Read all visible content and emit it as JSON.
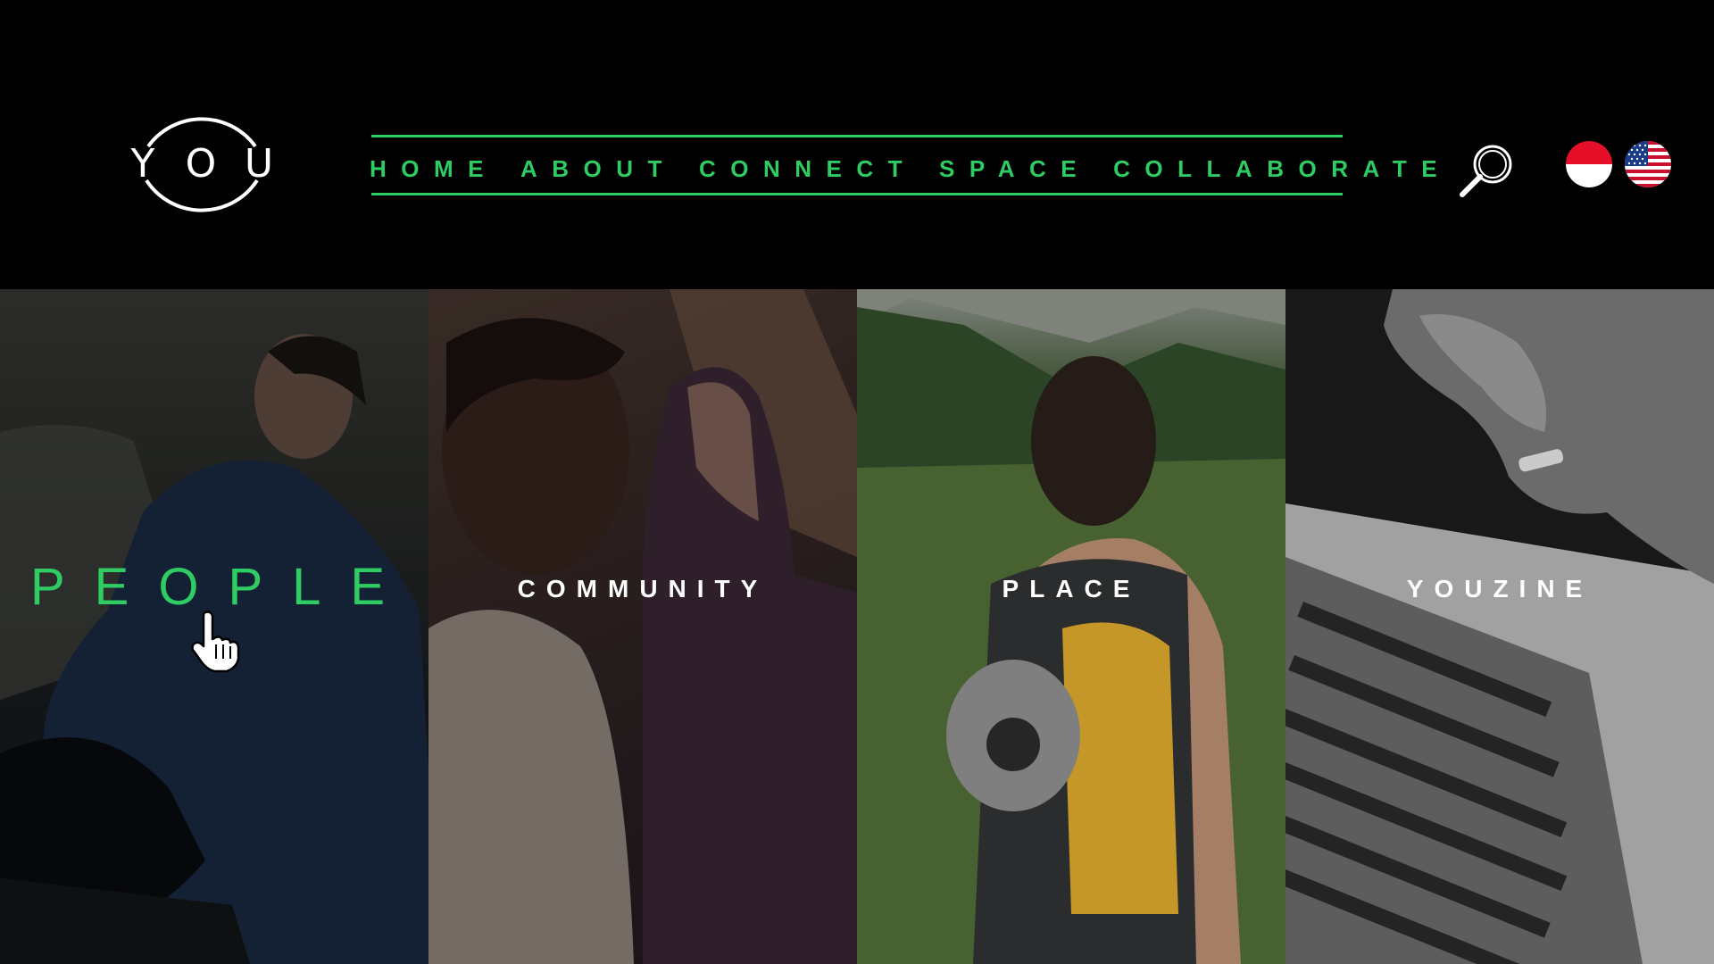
{
  "brand": {
    "logo_letters": [
      "Y",
      "O",
      "U"
    ]
  },
  "nav": {
    "items": [
      {
        "label": "HOME"
      },
      {
        "label": "ABOUT"
      },
      {
        "label": "CONNECT"
      },
      {
        "label": "SPACE"
      },
      {
        "label": "COLLABORATE"
      }
    ],
    "accent_color": "#2ecc62"
  },
  "header_icons": {
    "search": "search-icon",
    "languages": [
      "indonesia-flag-icon",
      "us-flag-icon"
    ]
  },
  "panels": [
    {
      "label": "PEOPLE",
      "active": true
    },
    {
      "label": "COMMUNITY",
      "active": false
    },
    {
      "label": "PLACE",
      "active": false
    },
    {
      "label": "YOUZINE",
      "active": false
    }
  ],
  "cursor": "pointer-hand-icon"
}
